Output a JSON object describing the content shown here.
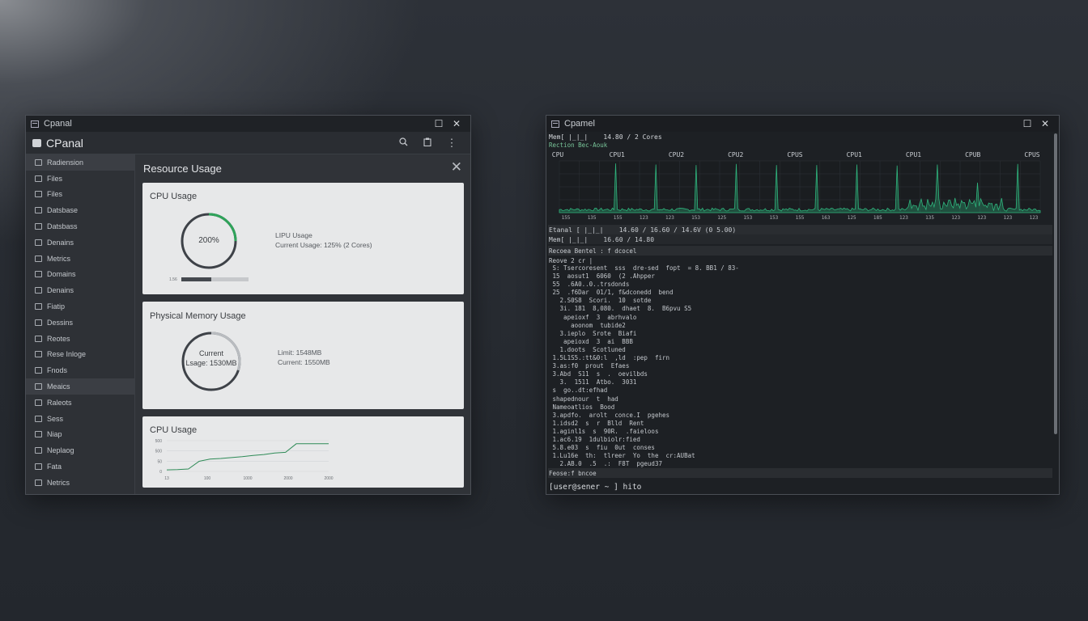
{
  "left_window": {
    "title": "Cpanal",
    "brand": "CPanal",
    "sidebar": [
      {
        "label": "Radiension",
        "active": true
      },
      {
        "label": "Files"
      },
      {
        "label": "Files"
      },
      {
        "label": "Datsbase"
      },
      {
        "label": "Datsbass"
      },
      {
        "label": "Denains"
      },
      {
        "label": "Metrics"
      },
      {
        "label": "Domains"
      },
      {
        "label": "Denains"
      },
      {
        "label": "Fiatip"
      },
      {
        "label": "Dessins"
      },
      {
        "label": "Reotes"
      },
      {
        "label": "Rese Inloge"
      },
      {
        "label": "Fnods"
      },
      {
        "label": "Meaics",
        "active": true
      },
      {
        "label": "Raleots"
      },
      {
        "label": "Sess"
      },
      {
        "label": "Niap"
      },
      {
        "label": "Neplaog"
      },
      {
        "label": "Fata"
      },
      {
        "label": "Netrics"
      }
    ],
    "main": {
      "title": "Resource Usage",
      "cpu_card": {
        "title": "CPU Usage",
        "gauge_value": "200%",
        "gauge_fraction": 0.25,
        "info_title": "LIPU Usage",
        "info_current": "Current Usage: 125% (2 Cores)",
        "bar_label": "1.56",
        "bar_fraction": 0.45
      },
      "memory_card": {
        "title": "Physical Memory Usage",
        "gauge_line1": "Current",
        "gauge_line2": "Lsage: 1530MB",
        "gauge_fraction": 0.3,
        "info_limit": "Limit: 1548MB",
        "info_current": "Current: 1550MB"
      },
      "cpu_chart_card": {
        "title": "CPU Usage"
      }
    }
  },
  "chart_data": [
    {
      "type": "line",
      "title": "CPU Usage",
      "x_ticks": [
        "13",
        "100",
        "1000",
        "2000",
        "2000"
      ],
      "y_ticks": [
        "500",
        "500",
        "50",
        "0"
      ],
      "series": [
        {
          "values": [
            0.05,
            0.06,
            0.08,
            0.33,
            0.4,
            0.42,
            0.45,
            0.48,
            0.52,
            0.55,
            0.6,
            0.62,
            0.9,
            0.9,
            0.9,
            0.9
          ]
        }
      ],
      "ylim": [
        0,
        1
      ],
      "color": "#2e8b57"
    },
    {
      "type": "line",
      "x_ticks": [
        "155",
        "135",
        "155",
        "123",
        "123",
        "153",
        "125",
        "153",
        "153",
        "155",
        "163",
        "125",
        "185",
        "123",
        "135",
        "123",
        "123",
        "123",
        "123"
      ],
      "categories": [
        "CPU",
        "CPU1",
        "CPU2",
        "CPU2",
        "CPUS",
        "CPU1",
        "CPU1",
        "CPUB",
        "CPUS"
      ],
      "spikes": [
        0.06,
        0.95,
        0.93,
        0.92,
        0.94,
        0.92,
        0.92,
        0.93,
        0.91,
        0.93,
        0.58,
        0.94
      ],
      "color": "#2fb37c",
      "grid": true
    }
  ],
  "right_window": {
    "title": "Cpamel",
    "header_line1": "Mem[ |_|_|    14.80 / 2 Cores",
    "header_line2": "Rection Bec-Aouk",
    "mid_line1": "Etanal [ |_|_|    14.60 / 16.60 / 14.6V (0 5.00)",
    "mid_line2": "Mem[ |_|_|    16.60 / 14.80",
    "section1": "Recoea Bentel : f dcocel",
    "section2": "Reove 2 cr |",
    "processes": [
      " S: Tsercoresent  sss  dre-sed  fopt  = 8. BB1 / 83-",
      " 15  aosut1  6060  (2 .Ahpper",
      " 55  .6A0..0..trsdonds",
      " 25  .f6Dar  01/1, f&dconedd  bend",
      "   2.S0S8  Scori.  10  sotde",
      "   3i. 181  8,080.  dhaet  8.  B6pvu S5",
      "    apeioxf  3  abrhvalo",
      "      aoonom  tubide2",
      "   3.ieplo  Srote  Biafi",
      "    apeioxd  3  ai  BBB",
      "   1.doots  Scotluned",
      " 1.5L1S5.:tt&0:l  ,ld  :pep  firn",
      " 3.as:f0  prout  Efaes",
      " 3.Abd  S11  s  .  oevilbds",
      "   3.  1511  Atbo.  3031",
      " s  go..dt:efhad",
      " shapednour  t  had",
      " Nameoatlios  Bood",
      " 3.apdfo.  arolt  conce.I  pgehes",
      " 1.idsd2  s  r  Blld  Rent",
      " 1.aginl1s  s  90R.  .faieloos",
      " 1.ac6.19  1dulbiolr:fied",
      " 5.8.e03  s  fiu  0ut  conses",
      " 1.Lu16e  th:  tlreer  Yo  the  cr:AUBat",
      "   2.AB.0  .5  .:  F8T  pgeud37"
    ],
    "footer": "Feose:f bncoe",
    "prompt": "[user@sener ~ ] hito"
  }
}
